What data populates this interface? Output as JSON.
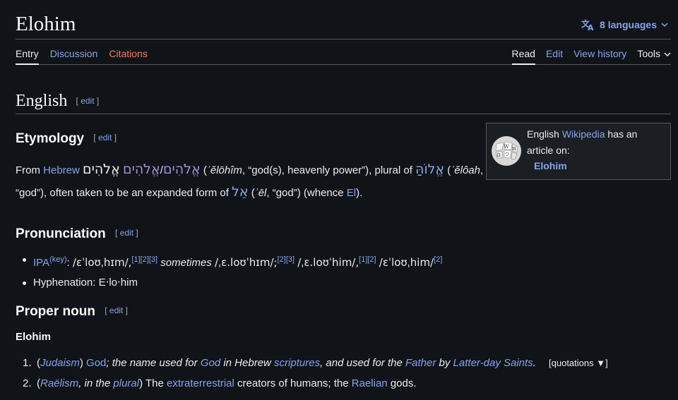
{
  "page_title": "Elohim",
  "languages_label": "8 languages",
  "tabs_left": [
    {
      "label": "Entry"
    },
    {
      "label": "Discussion"
    },
    {
      "label": "Citations"
    }
  ],
  "tabs_right": [
    {
      "label": "Read"
    },
    {
      "label": "Edit"
    },
    {
      "label": "View history"
    },
    {
      "label": "Tools"
    }
  ],
  "edit_link": "edit",
  "section_english": "English",
  "etymology": {
    "heading": "Etymology",
    "from": "From ",
    "hebrew": "Hebrew",
    "heb_word_a": "אֱלֹהִים",
    "slash": "/",
    "heb_word_b": "אֱלֹהִים",
    "translit1": "ʾĕlōhîm",
    "gloss1": ", “god(s), heavenly power”), plural of ",
    "heb_eloah": "אֱלוֹהַּ",
    "translit2": "ʾĕlôah",
    "line2_start": "“god”), often taken to be an expanded form of ",
    "heb_el": "אֵל",
    "translit3": "ʾēl",
    "gloss3": ", “god”) (whence ",
    "el_link": "El",
    "line2_end": ")."
  },
  "wikipedia_box": {
    "text_pre": "English ",
    "link": "Wikipedia",
    "text_post": " has an",
    "text_line2": "article on:",
    "article": "Elohim"
  },
  "pronunciation": {
    "heading": "Pronunciation",
    "ipa_label": "IPA",
    "key_label": "(key)",
    "ipa1": "/ɛˈloʊˌhɪm/,",
    "refs1": "[1][2][3]",
    "sometimes": "sometimes",
    "ipa2": "/ˌɛ.loʊˈhɪm/;",
    "refs2": "[2][3]",
    "ipa3": "/ˌɛ.loʊˈhim/,",
    "refs3": "[1][2]",
    "ipa4": "/ɛˈloʊˌhim/",
    "refs4": "[2]",
    "hyphenation": "Hyphenation: E‧lo‧him"
  },
  "proper_noun": {
    "heading": "Proper noun",
    "headword": "Elohim",
    "senses": [
      {
        "num": "1.",
        "lp": "(",
        "label": "Judaism",
        "rp": ")",
        "term": "God",
        "def1": "; the name used for ",
        "god_link": "God",
        "def2": " in Hebrew ",
        "scriptures": "scriptures",
        "def3": ", and used for the ",
        "father": "Father",
        "def4": " by ",
        "lds": "Latter-day Saints",
        "def5": ".",
        "quotations": "[quotations ▼]"
      },
      {
        "num": "2.",
        "lp": "(",
        "label": "Raëlism",
        "mid": ", in the ",
        "plural": "plural",
        "rp": ")",
        "def1": " The ",
        "et": "extraterrestrial",
        "def2": " creators of humans; the ",
        "raelian": "Raelian",
        "def3": " gods."
      }
    ]
  }
}
